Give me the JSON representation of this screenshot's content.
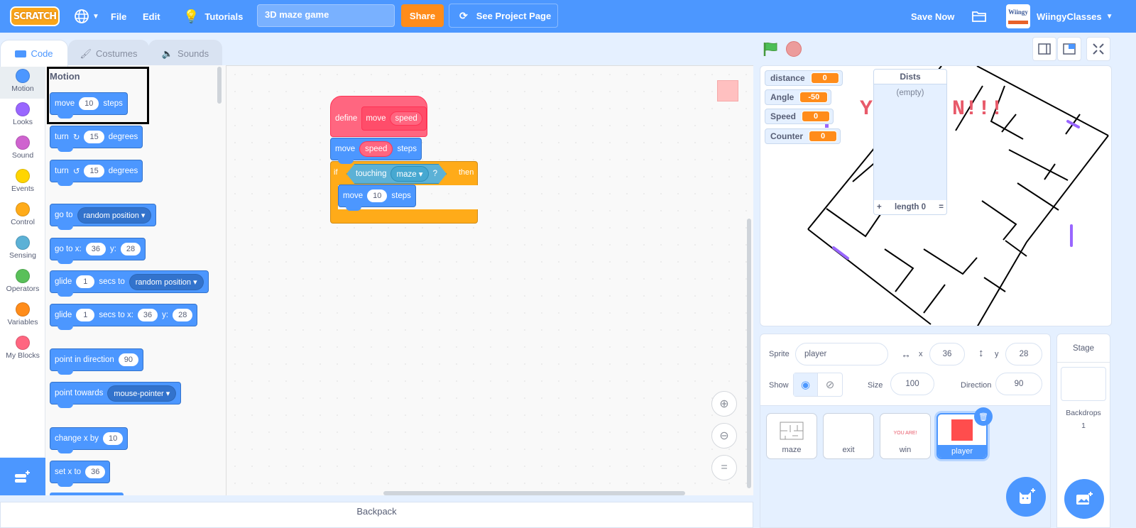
{
  "menubar": {
    "logo": "SCRATCH",
    "file": "File",
    "edit": "Edit",
    "tutorials": "Tutorials",
    "project_title": "3D maze game",
    "share": "Share",
    "see_project_page": "See Project Page",
    "save_now": "Save Now",
    "username": "WiingyClasses",
    "avatar_text": "Wiingy",
    "colors": {
      "bar": "#4c97ff",
      "share": "#ff8c1a"
    }
  },
  "tabs": [
    {
      "label": "Code",
      "active": true
    },
    {
      "label": "Costumes",
      "active": false
    },
    {
      "label": "Sounds",
      "active": false
    }
  ],
  "categories": [
    {
      "label": "Motion",
      "color": "#4c97ff"
    },
    {
      "label": "Looks",
      "color": "#9966ff"
    },
    {
      "label": "Sound",
      "color": "#cf63cf"
    },
    {
      "label": "Events",
      "color": "#ffd500"
    },
    {
      "label": "Control",
      "color": "#ffab19"
    },
    {
      "label": "Sensing",
      "color": "#5cb1d6"
    },
    {
      "label": "Operators",
      "color": "#59c059"
    },
    {
      "label": "Variables",
      "color": "#ff8c1a"
    },
    {
      "label": "My Blocks",
      "color": "#ff6680"
    }
  ],
  "palette": {
    "heading": "Motion",
    "blocks": {
      "move": {
        "a": "move",
        "v": "10",
        "b": "steps"
      },
      "turn_right": {
        "a": "turn",
        "v": "15",
        "b": "degrees"
      },
      "turn_left": {
        "a": "turn",
        "v": "15",
        "b": "degrees"
      },
      "goto": {
        "a": "go to",
        "d": "random position"
      },
      "gotoxy": {
        "a": "go to x:",
        "x": "36",
        "ylbl": "y:",
        "y": "28"
      },
      "glide_to": {
        "a": "glide",
        "v": "1",
        "b": "secs to",
        "d": "random position"
      },
      "glide_xy": {
        "a": "glide",
        "v": "1",
        "b": "secs to x:",
        "x": "36",
        "ylbl": "y:",
        "y": "28"
      },
      "point_dir": {
        "a": "point in direction",
        "v": "90"
      },
      "point_towards": {
        "a": "point towards",
        "d": "mouse-pointer"
      },
      "change_x": {
        "a": "change x by",
        "v": "10"
      },
      "set_x": {
        "a": "set x to",
        "v": "36"
      }
    }
  },
  "script": {
    "define": {
      "label": "define",
      "name": "move",
      "param": "speed"
    },
    "move_speed": {
      "a": "move",
      "v": "speed",
      "b": "steps"
    },
    "if_block": {
      "if": "if",
      "cond": "touching",
      "target": "maze",
      "q": "?",
      "then": "then"
    },
    "inner_move": {
      "a": "move",
      "v": "10",
      "b": "steps"
    }
  },
  "stage": {
    "monitors": [
      {
        "label": "distance",
        "value": "0"
      },
      {
        "label": "Angle",
        "value": "-50"
      },
      {
        "label": "Speed",
        "value": "0"
      },
      {
        "label": "Counter",
        "value": "0"
      }
    ],
    "list_monitor": {
      "title": "Dists",
      "empty": "(empty)",
      "add": "+",
      "length": "length 0",
      "resize": "="
    },
    "banner_text": "YOU WON!!!"
  },
  "sprite_info": {
    "sprite_label": "Sprite",
    "sprite_name": "player",
    "x_label": "x",
    "x": "36",
    "y_label": "y",
    "y": "28",
    "show_label": "Show",
    "size_label": "Size",
    "size": "100",
    "direction_label": "Direction",
    "direction": "90"
  },
  "sprites": [
    {
      "name": "maze",
      "selected": false
    },
    {
      "name": "exit",
      "selected": false
    },
    {
      "name": "win",
      "selected": false,
      "thumb_text": "YOU ARE!"
    },
    {
      "name": "player",
      "selected": true
    }
  ],
  "stage_pane": {
    "title": "Stage",
    "backdrops_label": "Backdrops",
    "backdrops_count": "1"
  },
  "backpack": "Backpack"
}
